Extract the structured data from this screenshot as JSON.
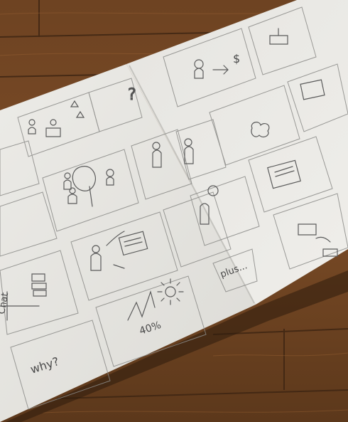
{
  "photo": {
    "subject": "Open storyboard sketchbook on wooden floor",
    "colors": {
      "wood_dark": "#5a371d",
      "wood_mid": "#7a4b26",
      "wood_light": "#9a6234",
      "paper": "#e9e8e4",
      "paper_shadow": "#d9d8d3",
      "pencil": "#5b5b5b"
    }
  },
  "notes": {
    "why": "why?",
    "plus": "plus...",
    "percent": "40%",
    "question": "?",
    "chat_label": "Chat",
    "dollar": "$"
  }
}
